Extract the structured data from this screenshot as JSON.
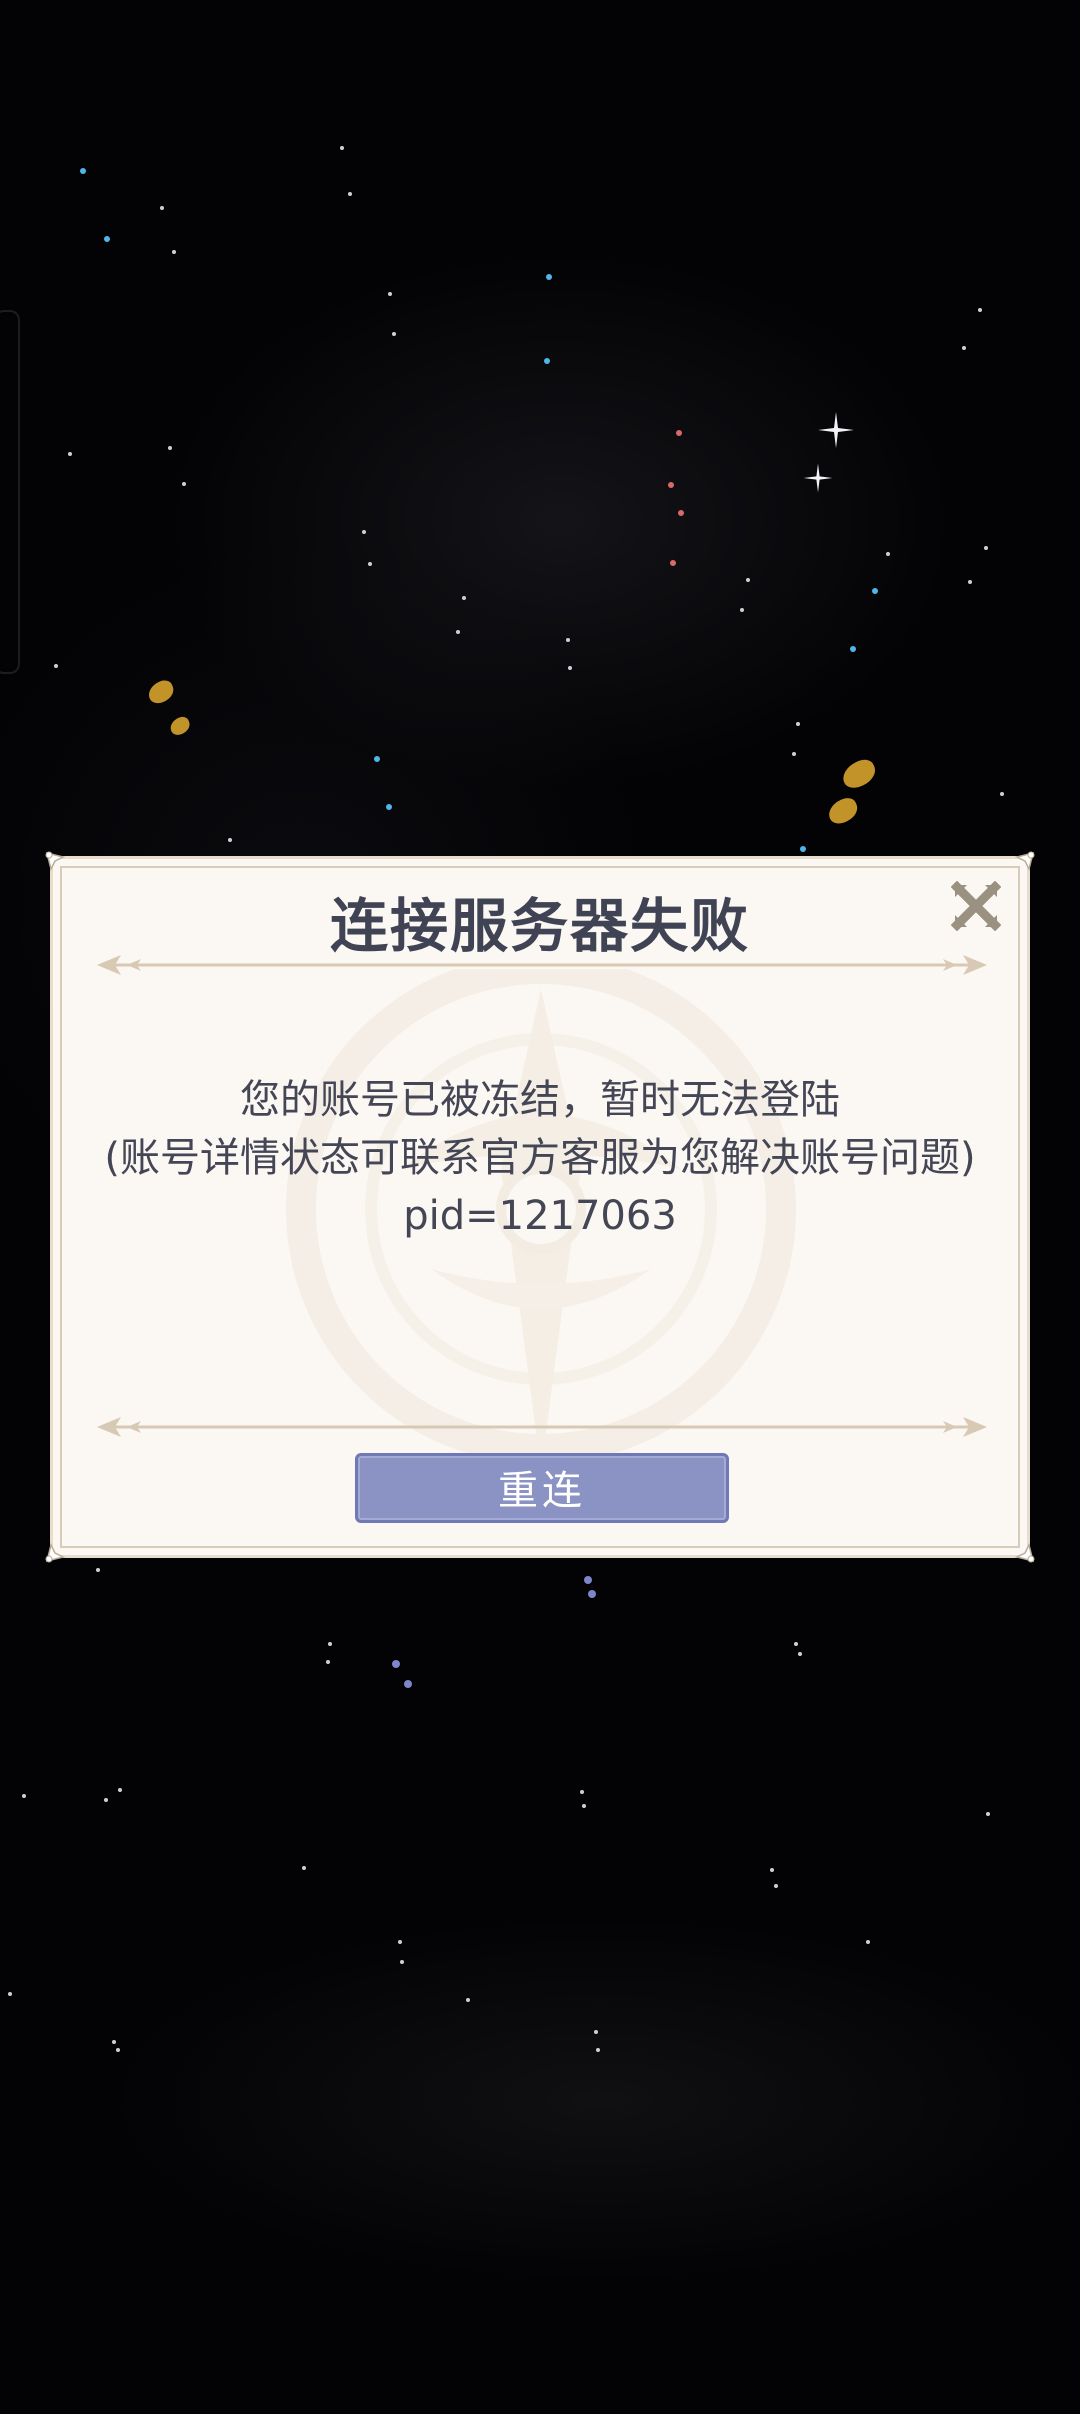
{
  "dialog": {
    "title": "连接服务器失败",
    "message_lines": [
      "您的账号已被冻结，暂时无法登陆",
      "(账号详情状态可联系官方客服为您解决账号问题)",
      "pid=1217063"
    ],
    "reconnect_label": "重连",
    "close_icon": "close-icon"
  },
  "colors": {
    "background": "#030305",
    "dialog_bg": "#fbf7f2",
    "title_text": "#3f4353",
    "button_bg": "#8a93c4",
    "accent_gold": "#d7a32c"
  }
}
